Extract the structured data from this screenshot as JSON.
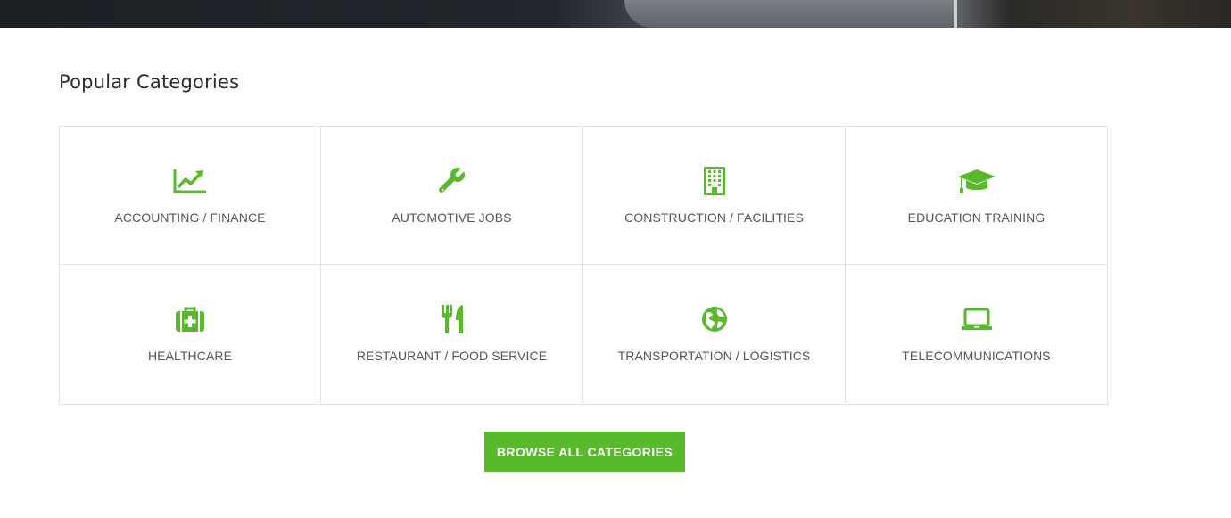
{
  "section": {
    "title": "Popular Categories"
  },
  "categories": [
    {
      "label": "ACCOUNTING / FINANCE",
      "icon": "line-chart-icon"
    },
    {
      "label": "AUTOMOTIVE JOBS",
      "icon": "wrench-icon"
    },
    {
      "label": "CONSTRUCTION / FACILITIES",
      "icon": "building-icon"
    },
    {
      "label": "EDUCATION TRAINING",
      "icon": "graduation-cap-icon"
    },
    {
      "label": "HEALTHCARE",
      "icon": "medkit-icon"
    },
    {
      "label": "RESTAURANT / FOOD SERVICE",
      "icon": "cutlery-icon"
    },
    {
      "label": "TRANSPORTATION / LOGISTICS",
      "icon": "globe-icon"
    },
    {
      "label": "TELECOMMUNICATIONS",
      "icon": "laptop-icon"
    }
  ],
  "browse_button": {
    "label": "BROWSE ALL CATEGORIES"
  },
  "colors": {
    "accent": "#58b92b",
    "text": "#555555",
    "title": "#2b2b2b",
    "border": "#e2e2e2"
  }
}
